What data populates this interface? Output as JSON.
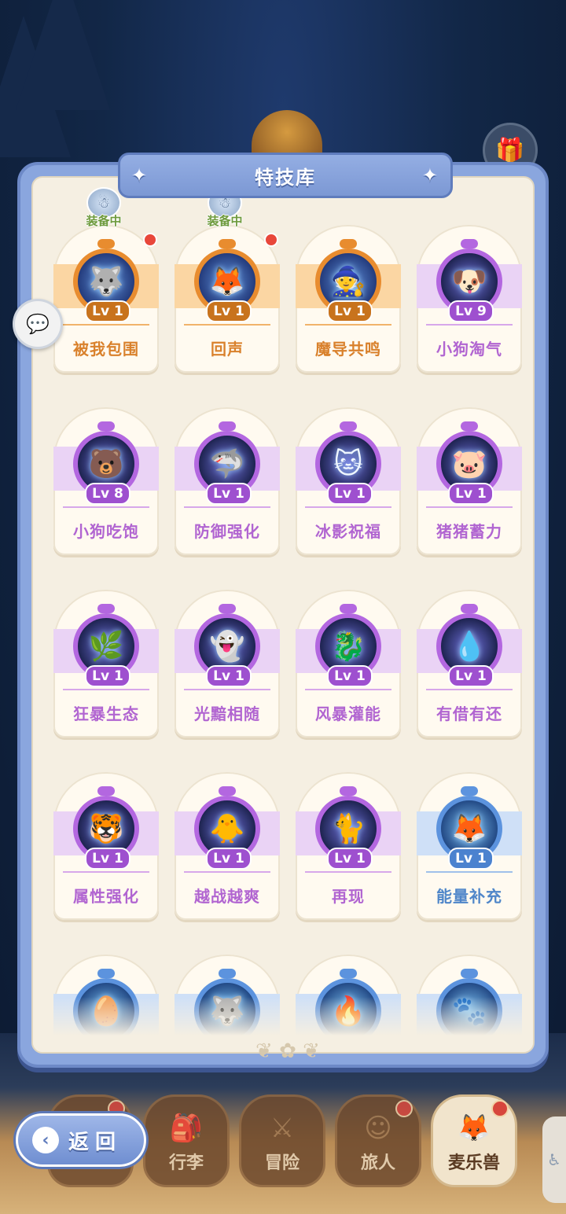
{
  "title": "特技库",
  "equipped_label": "装备中",
  "skills": [
    {
      "name": "被我包围",
      "level": "Lv 1",
      "theme": "orange",
      "icon": "wolf-icon",
      "glyph": "🐺",
      "equipped": true,
      "has_dot": true
    },
    {
      "name": "回声",
      "level": "Lv 1",
      "theme": "orange",
      "icon": "fox-icon",
      "glyph": "🦊",
      "equipped": true,
      "has_dot": true
    },
    {
      "name": "魔导共鸣",
      "level": "Lv 1",
      "theme": "orange",
      "icon": "wizard-icon",
      "glyph": "🧙",
      "equipped": false,
      "has_dot": false
    },
    {
      "name": "小狗淘气",
      "level": "Lv 9",
      "theme": "purple",
      "icon": "puppy-icon",
      "glyph": "🐶",
      "equipped": false,
      "has_dot": false
    },
    {
      "name": "小狗吃饱",
      "level": "Lv 8",
      "theme": "purple",
      "icon": "bear-dog-icon",
      "glyph": "🐻",
      "equipped": false,
      "has_dot": false
    },
    {
      "name": "防御强化",
      "level": "Lv 1",
      "theme": "purple",
      "icon": "shark-icon",
      "glyph": "🦈",
      "equipped": false,
      "has_dot": false
    },
    {
      "name": "冰影祝福",
      "level": "Lv 1",
      "theme": "purple",
      "icon": "ice-cat-icon",
      "glyph": "🐱",
      "equipped": false,
      "has_dot": false
    },
    {
      "name": "猪猪蓄力",
      "level": "Lv 1",
      "theme": "purple",
      "icon": "pig-icon",
      "glyph": "🐷",
      "equipped": false,
      "has_dot": false
    },
    {
      "name": "狂暴生态",
      "level": "Lv 1",
      "theme": "purple",
      "icon": "forest-spirit-icon",
      "glyph": "🌿",
      "equipped": false,
      "has_dot": false
    },
    {
      "name": "光黯相随",
      "level": "Lv 1",
      "theme": "purple",
      "icon": "shadow-blob-icon",
      "glyph": "👻",
      "equipped": false,
      "has_dot": false
    },
    {
      "name": "风暴灌能",
      "level": "Lv 1",
      "theme": "purple",
      "icon": "storm-beast-icon",
      "glyph": "🐉",
      "equipped": false,
      "has_dot": false
    },
    {
      "name": "有借有还",
      "level": "Lv 1",
      "theme": "purple",
      "icon": "ice-blob-icon",
      "glyph": "💧",
      "equipped": false,
      "has_dot": false
    },
    {
      "name": "属性强化",
      "level": "Lv 1",
      "theme": "purple",
      "icon": "fire-cat-icon",
      "glyph": "🐯",
      "equipped": false,
      "has_dot": false
    },
    {
      "name": "越战越爽",
      "level": "Lv 1",
      "theme": "purple",
      "icon": "fire-bird-icon",
      "glyph": "🐥",
      "equipped": false,
      "has_dot": false
    },
    {
      "name": "再现",
      "level": "Lv 1",
      "theme": "purple",
      "icon": "dark-cat-icon",
      "glyph": "🐈",
      "equipped": false,
      "has_dot": false
    },
    {
      "name": "能量补充",
      "level": "Lv 1",
      "theme": "blue",
      "icon": "fox-red-icon",
      "glyph": "🦊",
      "equipped": false,
      "has_dot": false
    },
    {
      "name": "",
      "level": "",
      "theme": "blue",
      "icon": "egg-icon",
      "glyph": "🥚",
      "equipped": false,
      "has_dot": false
    },
    {
      "name": "",
      "level": "",
      "theme": "blue",
      "icon": "blue-beast-icon",
      "glyph": "🐺",
      "equipped": false,
      "has_dot": false
    },
    {
      "name": "",
      "level": "",
      "theme": "blue",
      "icon": "sun-flame-icon",
      "glyph": "🔥",
      "equipped": false,
      "has_dot": false
    },
    {
      "name": "",
      "level": "",
      "theme": "blue",
      "icon": "ghost-fox-icon",
      "glyph": "🐾",
      "equipped": false,
      "has_dot": false
    }
  ],
  "back_button": "返回",
  "nav": [
    {
      "label": "",
      "icon": "home-icon",
      "glyph": "⌂",
      "has_dot": true,
      "active": false
    },
    {
      "label": "行李",
      "icon": "backpack-icon",
      "glyph": "🎒",
      "has_dot": false,
      "active": false
    },
    {
      "label": "冒险",
      "icon": "crossed-swords-icon",
      "glyph": "⚔",
      "has_dot": false,
      "active": false
    },
    {
      "label": "旅人",
      "icon": "traveler-icon",
      "glyph": "☺",
      "has_dot": true,
      "active": false
    },
    {
      "label": "麦乐兽",
      "icon": "pet-fox-icon",
      "glyph": "🦊",
      "has_dot": true,
      "active": true
    }
  ],
  "colors": {
    "accent": "#7c98d4",
    "orange": "#e88c2f",
    "purple": "#b367e0",
    "blue": "#5c93de"
  }
}
